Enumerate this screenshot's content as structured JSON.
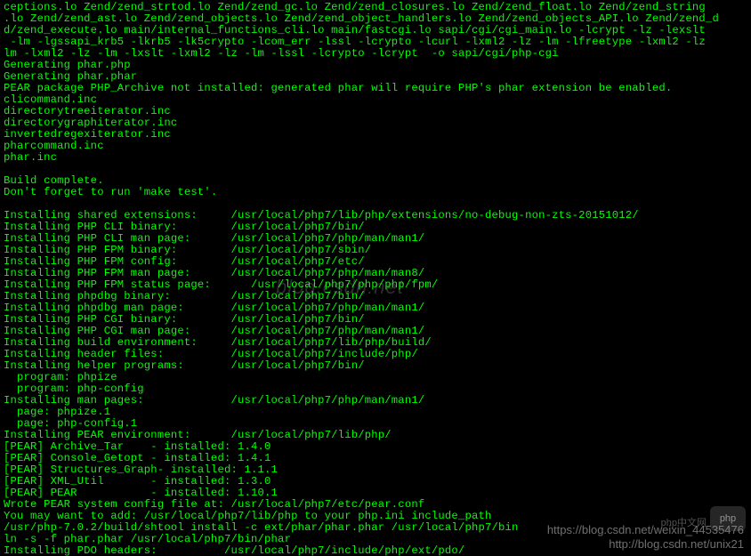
{
  "terminal": {
    "lines": [
      "ceptions.lo Zend/zend_strtod.lo Zend/zend_gc.lo Zend/zend_closures.lo Zend/zend_float.lo Zend/zend_string",
      ".lo Zend/zend_ast.lo Zend/zend_objects.lo Zend/zend_object_handlers.lo Zend/zend_objects_API.lo Zend/zend_d",
      "d/zend_execute.lo main/internal_functions_cli.lo main/fastcgi.lo sapi/cgi/cgi_main.lo -lcrypt -lz -lexslt",
      " -lm -lgssapi_krb5 -lkrb5 -lk5crypto -lcom_err -lssl -lcrypto -lcurl -lxml2 -lz -lm -lfreetype -lxml2 -lz",
      "lm -lxml2 -lz -lm -lxslt -lxml2 -lz -lm -lssl -lcrypto -lcrypt  -o sapi/cgi/php-cgi",
      "Generating phar.php",
      "Generating phar.phar",
      "PEAR package PHP_Archive not installed: generated phar will require PHP's phar extension be enabled.",
      "clicommand.inc",
      "directorytreeiterator.inc",
      "directorygraphiterator.inc",
      "invertedregexiterator.inc",
      "pharcommand.inc",
      "phar.inc",
      "",
      "Build complete.",
      "Don't forget to run 'make test'.",
      "",
      "Installing shared extensions:     /usr/local/php7/lib/php/extensions/no-debug-non-zts-20151012/",
      "Installing PHP CLI binary:        /usr/local/php7/bin/",
      "Installing PHP CLI man page:      /usr/local/php7/php/man/man1/",
      "Installing PHP FPM binary:        /usr/local/php7/sbin/",
      "Installing PHP FPM config:        /usr/local/php7/etc/",
      "Installing PHP FPM man page:      /usr/local/php7/php/man/man8/",
      "Installing PHP FPM status page:      /usr/local/php7/php/php/fpm/",
      "Installing phpdbg binary:         /usr/local/php7/bin/",
      "Installing phpdbg man page:       /usr/local/php7/php/man/man1/",
      "Installing PHP CGI binary:        /usr/local/php7/bin/",
      "Installing PHP CGI man page:      /usr/local/php7/php/man/man1/",
      "Installing build environment:     /usr/local/php7/lib/php/build/",
      "Installing header files:          /usr/local/php7/include/php/",
      "Installing helper programs:       /usr/local/php7/bin/",
      "  program: phpize",
      "  program: php-config",
      "Installing man pages:             /usr/local/php7/php/man/man1/",
      "  page: phpize.1",
      "  page: php-config.1",
      "Installing PEAR environment:      /usr/local/php7/lib/php/",
      "[PEAR] Archive_Tar    - installed: 1.4.0",
      "[PEAR] Console_Getopt - installed: 1.4.1",
      "[PEAR] Structures_Graph- installed: 1.1.1",
      "[PEAR] XML_Util       - installed: 1.3.0",
      "[PEAR] PEAR           - installed: 1.10.1",
      "Wrote PEAR system config file at: /usr/local/php7/etc/pear.conf",
      "You may want to add: /usr/local/php7/lib/php to your php.ini include_path",
      "/usr/php-7.0.2/build/shtool install -c ext/phar/phar.phar /usr/local/php7/bin",
      "ln -s -f phar.phar /usr/local/php7/bin/phar",
      "Installing PDO headers:          /usr/local/php7/include/php/ext/pdo/"
    ]
  },
  "watermarks": {
    "center": "blog.csdn.net",
    "url1": "https://blog.csdn.net/weixin_44535476",
    "url2": "http://blog.csdn.net/unix21",
    "logo_text": "php中文网",
    "logo": "php"
  }
}
